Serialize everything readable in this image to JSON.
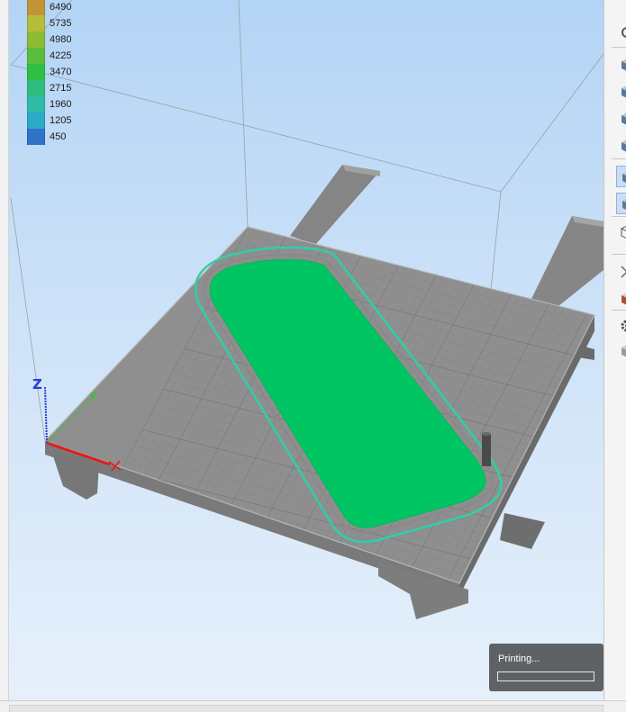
{
  "legend": {
    "items": [
      {
        "label": "6490",
        "color": "#c39436"
      },
      {
        "label": "5735",
        "color": "#b5bd3a"
      },
      {
        "label": "4980",
        "color": "#8dbb33"
      },
      {
        "label": "4225",
        "color": "#5bbd3c"
      },
      {
        "label": "3470",
        "color": "#2fbe46"
      },
      {
        "label": "2715",
        "color": "#2fbc7c"
      },
      {
        "label": "1960",
        "color": "#2ebca6"
      },
      {
        "label": "1205",
        "color": "#2ba9c7"
      },
      {
        "label": "450",
        "color": "#2f72c8"
      }
    ]
  },
  "axes": {
    "z_label": "Z",
    "x_color": "#e21b1b",
    "y_color": "#3ac43a",
    "z_color": "#2a3fd6"
  },
  "print": {
    "status_label": "Printing...",
    "progress": 0.0
  },
  "colors": {
    "toolpath": "#00c864",
    "skirt": "#2fcfa8",
    "bed": "#8c8c8c"
  },
  "toolbar": {
    "icons": [
      "rotate-icon",
      "view-cube-icon",
      "view-cube-icon",
      "view-cube-icon",
      "view-cube-icon",
      "view-cube-icon",
      "view-cube-icon",
      "wireframe-cube-icon",
      "cut-icon",
      "color-cube-icon",
      "gear-icon",
      "settings-cube-icon"
    ]
  }
}
